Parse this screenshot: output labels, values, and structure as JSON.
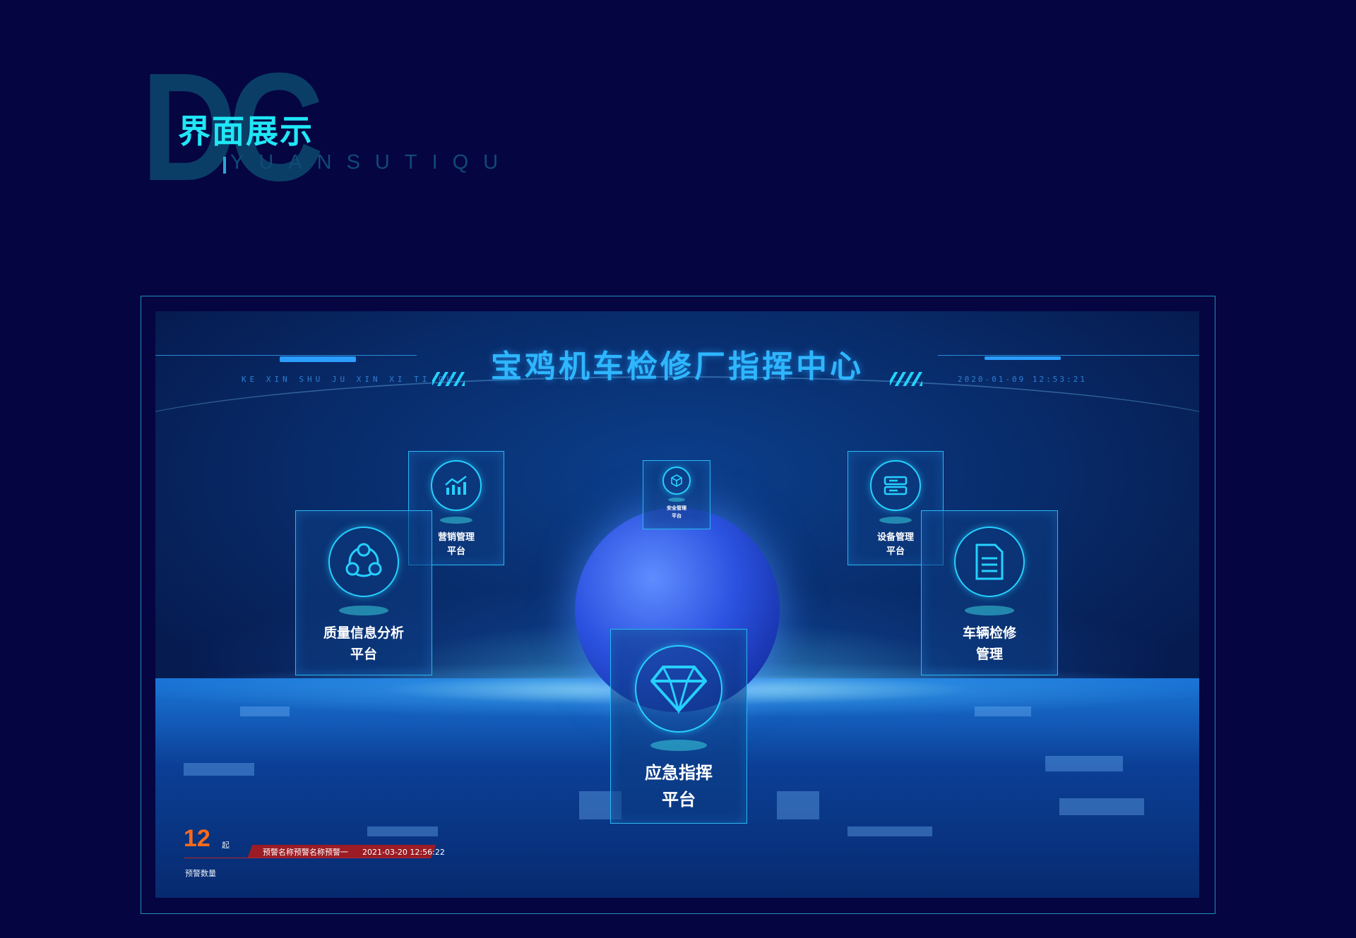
{
  "section": {
    "deco_letters": "DC",
    "title": "界面展示",
    "subtitle": "YUANSUTIQU"
  },
  "screen": {
    "title": "宝鸡机车检修厂指挥中心",
    "pinyin": "KE XIN SHU JU XIN XI TI QU",
    "datetime": "2020-01-09 12:53:21",
    "cards": [
      {
        "id": "marketing",
        "icon": "trend-chart-icon",
        "label": "营销管理\n平台"
      },
      {
        "id": "quality",
        "icon": "molecule-icon",
        "label": "质量信息分析\n平台"
      },
      {
        "id": "safety",
        "icon": "cube-icon",
        "label": "安全管理\n平台"
      },
      {
        "id": "equipment",
        "icon": "server-icon",
        "label": "设备管理\n平台"
      },
      {
        "id": "vehicle",
        "icon": "document-icon",
        "label": "车辆检修\n管理"
      },
      {
        "id": "emergency",
        "icon": "diamond-icon",
        "label": "应急指挥\n平台"
      }
    ],
    "warning": {
      "count": "12",
      "unit": "起",
      "caption": "预警数量",
      "name": "预警名称预警名称预警一",
      "time": "2021-03-20 12:56:22"
    }
  },
  "colors": {
    "background": "#050541",
    "accent": "#20e6f6",
    "title_blue": "#2eb6ff",
    "warning_orange": "#ff6a1a",
    "warning_bar": "#9b1c25"
  }
}
